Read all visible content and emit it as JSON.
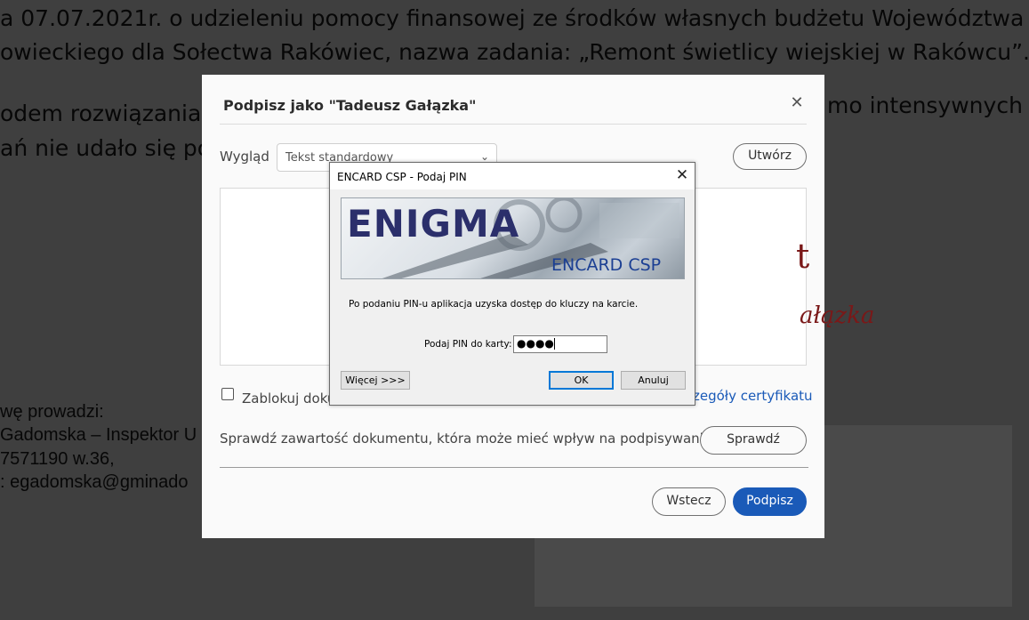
{
  "background_document": {
    "line1": "a 07.07.2021r. o udzieleniu pomocy finansowej ze środków własnych budżetu Województwa",
    "line2": "owieckiego dla  Sołectwa Rakówiec, nazwa zadania: „Remont świetlicy wiejskiej w Rakówcu”.",
    "line3_left": "odem rozwiązania w",
    "line3_right": "mo intensywnych",
    "line4_left": "ań nie udało się poz",
    "contact1": "wę prowadzi:",
    "contact2": "Gadomska – Inspektor U",
    "contact3": "7571190 w.36,",
    "contact4": ": egadomska@gminado"
  },
  "adobe_dialog": {
    "title": "Podpisz jako \"Tadeusz Gałązka\"",
    "appearance_label": "Wygląd",
    "appearance_value": "Tekst standardowy",
    "create_button": "Utwórz",
    "preview_name1": "t",
    "preview_name2": "ałązka",
    "lock_label": "Zablokuj doku",
    "cert_details_link": "zegóły certyfikatu",
    "check_text": "Sprawdź zawartość dokumentu, która może mieć wpływ na podpisywanie",
    "check_button": "Sprawdź",
    "back_button": "Wstecz",
    "sign_button": "Podpisz"
  },
  "encard_dialog": {
    "title": "ENCARD CSP - Podaj PIN",
    "banner_logo": "ENIGMA",
    "banner_sub": "ENCARD CSP",
    "message": "Po podaniu PIN-u aplikacja uzyska dostęp do kluczy na karcie.",
    "pin_label": "Podaj PIN do karty:",
    "pin_value": "●●●●",
    "more_button": "Więcej >>>",
    "ok_button": "OK",
    "cancel_button": "Anuluj"
  },
  "icons": {
    "close": "close-icon",
    "chevron": "chevron-down-icon"
  },
  "colors": {
    "primary_blue": "#1a5ab8",
    "overlay": "#3f3f3f",
    "signature_red": "#7a1818",
    "windows_focus": "#0078d7"
  }
}
